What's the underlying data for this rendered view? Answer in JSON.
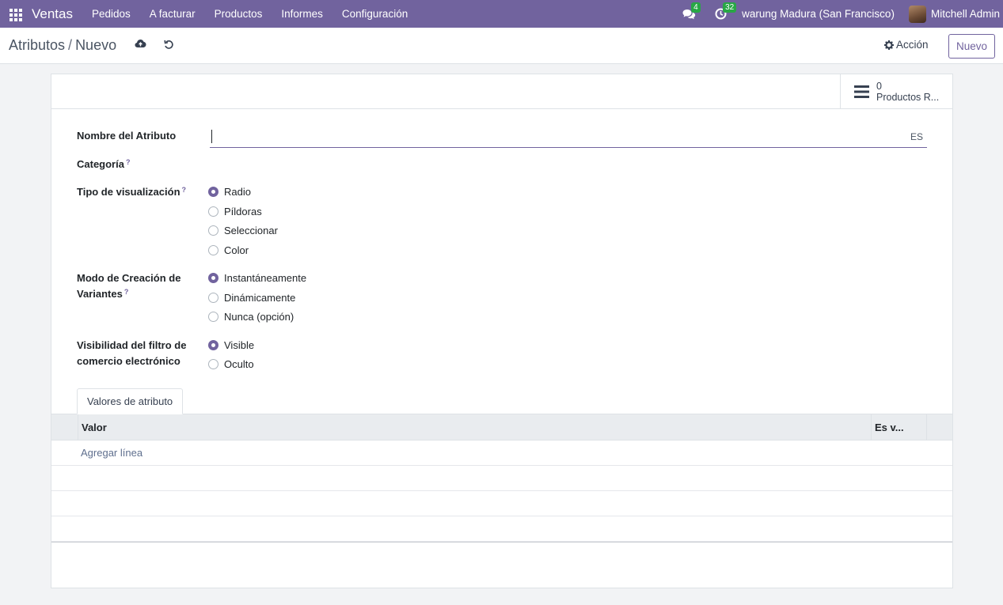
{
  "navbar": {
    "brand": "Ventas",
    "menu": [
      "Pedidos",
      "A facturar",
      "Productos",
      "Informes",
      "Configuración"
    ],
    "messages_count": "4",
    "activities_count": "32",
    "company": "warung Madura (San Francisco)",
    "user": "Mitchell Admin"
  },
  "control": {
    "breadcrumb_parent": "Atributos",
    "breadcrumb_separator": "/",
    "breadcrumb_current": "Nuevo",
    "action_label": "Acción",
    "new_label": "Nuevo"
  },
  "smart_button": {
    "count": "0",
    "label": "Productos R..."
  },
  "form": {
    "name_label": "Nombre del Atributo",
    "name_value": "",
    "lang": "ES",
    "category_label": "Categoría",
    "tooltip_mark": "?",
    "display_type_label": "Tipo de visualización",
    "display_type_options": [
      "Radio",
      "Píldoras",
      "Seleccionar",
      "Color"
    ],
    "display_type_selected": "Radio",
    "variant_mode_label_line1": "Modo de Creación de",
    "variant_mode_label_line2": "Variantes",
    "variant_mode_options": [
      "Instantáneamente",
      "Dinámicamente",
      "Nunca (opción)"
    ],
    "variant_mode_selected": "Instantáneamente",
    "visibility_label_line1": "Visibilidad del filtro de",
    "visibility_label_line2": "comercio electrónico",
    "visibility_options": [
      "Visible",
      "Oculto"
    ],
    "visibility_selected": "Visible"
  },
  "tabs": {
    "values_tab": "Valores de atributo"
  },
  "table": {
    "columns": [
      "Valor",
      "Es v..."
    ],
    "add_line": "Agregar línea"
  },
  "colors": {
    "brand": "#71639e",
    "badge": "#28a745"
  }
}
